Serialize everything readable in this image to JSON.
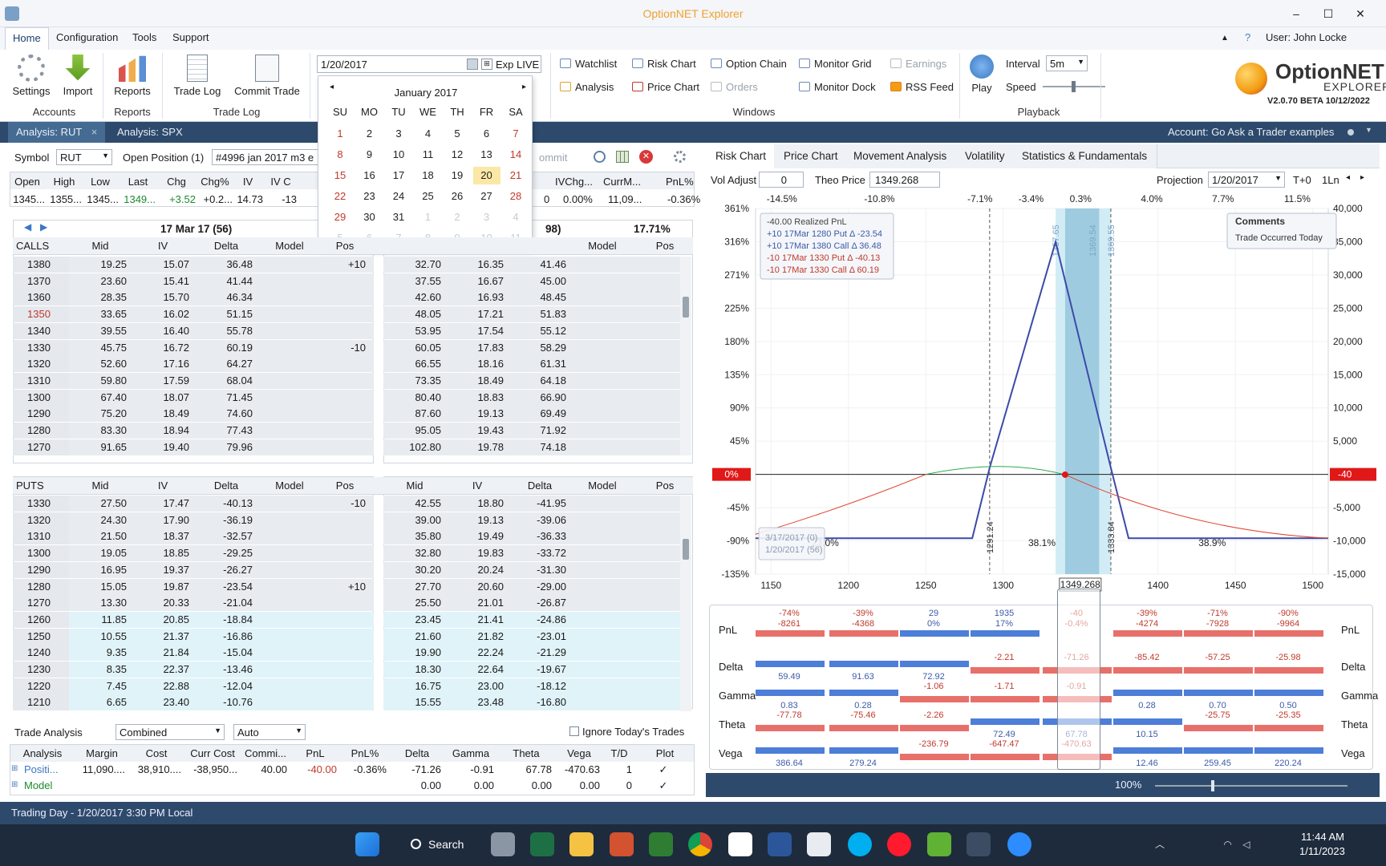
{
  "window": {
    "title": "OptionNET Explorer",
    "user": "User: John Locke"
  },
  "menu": [
    "Home",
    "Configuration",
    "Tools",
    "Support"
  ],
  "ribbon": {
    "settings": "Settings",
    "import": "Import",
    "reports": "Reports",
    "trade_log": "Trade Log",
    "commit_trade": "Commit Trade",
    "groups": {
      "accounts": "Accounts",
      "reports": "Reports",
      "trade_log": "Trade Log",
      "windows": "Windows",
      "playback": "Playback"
    },
    "date_value": "1/20/2017",
    "exp_label": "Exp LIVE",
    "windows": {
      "watchlist": "Watchlist",
      "risk_chart": "Risk Chart",
      "option_chain": "Option Chain",
      "monitor_grid": "Monitor Grid",
      "earnings": "Earnings",
      "analysis": "Analysis",
      "price_chart": "Price Chart",
      "orders": "Orders",
      "monitor_dock": "Monitor Dock",
      "rss_feed": "RSS Feed"
    },
    "play": "Play",
    "interval_label": "Interval",
    "interval_value": "5m",
    "speed_label": "Speed",
    "logo": "OptionNET",
    "logo_sub": "EXPLORER",
    "version": "V2.0.70 BETA 10/12/2022"
  },
  "analysis_tabs": [
    "Analysis: RUT",
    "Analysis: SPX"
  ],
  "account": "Account: Go Ask a Trader examples",
  "symbol": {
    "label": "Symbol",
    "value": "RUT",
    "open_pos_label": "Open Position (1)",
    "open_pos_value": "#4996 jan 2017 m3 e",
    "commit": "ommit"
  },
  "quote": {
    "headers": [
      "Open",
      "High",
      "Low",
      "Last",
      "Chg",
      "Chg%",
      "IV",
      "IV C"
    ],
    "values": [
      "1345...",
      "1355...",
      "1345...",
      "1349...",
      "+3.52",
      "+0.2...",
      "14.73",
      "-13"
    ],
    "headers2": [
      "IVChg...",
      "CurrM...",
      "PnL%"
    ],
    "values2": [
      "0",
      "0.00%",
      "11,09...",
      "-0.36%"
    ]
  },
  "calendar": {
    "month": "January 2017",
    "dow": [
      "SU",
      "MO",
      "TU",
      "WE",
      "TH",
      "FR",
      "SA"
    ],
    "weeks": [
      [
        "1",
        "2",
        "3",
        "4",
        "5",
        "6",
        "7"
      ],
      [
        "8",
        "9",
        "10",
        "11",
        "12",
        "13",
        "14"
      ],
      [
        "15",
        "16",
        "17",
        "18",
        "19",
        "20",
        "21"
      ],
      [
        "22",
        "23",
        "24",
        "25",
        "26",
        "27",
        "28"
      ],
      [
        "29",
        "30",
        "31",
        "1",
        "2",
        "3",
        "4"
      ],
      [
        "5",
        "6",
        "7",
        "8",
        "9",
        "10",
        "11"
      ]
    ],
    "selected": "20"
  },
  "calls": {
    "label": "CALLS",
    "exp_left": "17 Mar 17 (56)",
    "exp_right": "98)",
    "exp_right_iv": "17.71%",
    "cols": [
      "Mid",
      "IV",
      "Delta",
      "Model",
      "Pos"
    ],
    "rows": [
      [
        "1380",
        "19.25",
        "15.07",
        "36.48",
        "+10",
        "32.70",
        "16.35",
        "41.46"
      ],
      [
        "1370",
        "23.60",
        "15.41",
        "41.44",
        "",
        "37.55",
        "16.67",
        "45.00"
      ],
      [
        "1360",
        "28.35",
        "15.70",
        "46.34",
        "",
        "42.60",
        "16.93",
        "48.45"
      ],
      [
        "1350",
        "33.65",
        "16.02",
        "51.15",
        "",
        "48.05",
        "17.21",
        "51.83"
      ],
      [
        "1340",
        "39.55",
        "16.40",
        "55.78",
        "",
        "53.95",
        "17.54",
        "55.12"
      ],
      [
        "1330",
        "45.75",
        "16.72",
        "60.19",
        "-10",
        "60.05",
        "17.83",
        "58.29"
      ],
      [
        "1320",
        "52.60",
        "17.16",
        "64.27",
        "",
        "66.55",
        "18.16",
        "61.31"
      ],
      [
        "1310",
        "59.80",
        "17.59",
        "68.04",
        "",
        "73.35",
        "18.49",
        "64.18"
      ],
      [
        "1300",
        "67.40",
        "18.07",
        "71.45",
        "",
        "80.40",
        "18.83",
        "66.90"
      ],
      [
        "1290",
        "75.20",
        "18.49",
        "74.60",
        "",
        "87.60",
        "19.13",
        "69.49"
      ],
      [
        "1280",
        "83.30",
        "18.94",
        "77.43",
        "",
        "95.05",
        "19.43",
        "71.92"
      ],
      [
        "1270",
        "91.65",
        "19.40",
        "79.96",
        "",
        "102.80",
        "19.78",
        "74.18"
      ]
    ]
  },
  "puts": {
    "label": "PUTS",
    "cols": [
      "Mid",
      "IV",
      "Delta",
      "Model",
      "Pos"
    ],
    "rows": [
      [
        "1330",
        "27.50",
        "17.47",
        "-40.13",
        "-10",
        "42.55",
        "18.80",
        "-41.95"
      ],
      [
        "1320",
        "24.30",
        "17.90",
        "-36.19",
        "",
        "39.00",
        "19.13",
        "-39.06"
      ],
      [
        "1310",
        "21.50",
        "18.37",
        "-32.57",
        "",
        "35.80",
        "19.49",
        "-36.33"
      ],
      [
        "1300",
        "19.05",
        "18.85",
        "-29.25",
        "",
        "32.80",
        "19.83",
        "-33.72"
      ],
      [
        "1290",
        "16.95",
        "19.37",
        "-26.27",
        "",
        "30.20",
        "20.24",
        "-31.30"
      ],
      [
        "1280",
        "15.05",
        "19.87",
        "-23.54",
        "+10",
        "27.70",
        "20.60",
        "-29.00"
      ],
      [
        "1270",
        "13.30",
        "20.33",
        "-21.04",
        "",
        "25.50",
        "21.01",
        "-26.87"
      ],
      [
        "1260",
        "11.85",
        "20.85",
        "-18.84",
        "",
        "23.45",
        "21.41",
        "-24.86"
      ],
      [
        "1250",
        "10.55",
        "21.37",
        "-16.86",
        "",
        "21.60",
        "21.82",
        "-23.01"
      ],
      [
        "1240",
        "9.35",
        "21.84",
        "-15.04",
        "",
        "19.90",
        "22.24",
        "-21.29"
      ],
      [
        "1230",
        "8.35",
        "22.37",
        "-13.46",
        "",
        "18.30",
        "22.64",
        "-19.67"
      ],
      [
        "1220",
        "7.45",
        "22.88",
        "-12.04",
        "",
        "16.75",
        "23.00",
        "-18.12"
      ],
      [
        "1210",
        "6.65",
        "23.40",
        "-10.76",
        "",
        "15.55",
        "23.48",
        "-16.80"
      ]
    ]
  },
  "trade_analysis": {
    "label": "Trade Analysis",
    "mode": "Combined",
    "auto": "Auto",
    "ignore": "Ignore Today's Trades",
    "cols": [
      "Analysis",
      "Margin",
      "Cost",
      "Curr Cost",
      "Commi...",
      "PnL",
      "PnL%",
      "Delta",
      "Gamma",
      "Theta",
      "Vega",
      "T/D",
      "Plot"
    ],
    "rows": [
      [
        "Positi...",
        "11,090....",
        "38,910....",
        "-38,950...",
        "40.00",
        "-40.00",
        "-0.36%",
        "-71.26",
        "-0.91",
        "67.78",
        "-470.63",
        "1",
        "✓"
      ],
      [
        "Model",
        "",
        "",
        "",
        "",
        "",
        "",
        "0.00",
        "0.00",
        "0.00",
        "0.00",
        "0",
        "✓"
      ]
    ]
  },
  "chart_tabs": [
    "Risk Chart",
    "Price Chart",
    "Movement Analysis",
    "Volatility",
    "Statistics & Fundamentals"
  ],
  "chart_ctrl": {
    "vol_label": "Vol Adjust",
    "vol_value": "0",
    "theo_label": "Theo Price",
    "theo_value": "1349.268",
    "proj_label": "Projection",
    "proj_value": "1/20/2017",
    "tplus": "T+0",
    "ln": "1Ln"
  },
  "chart_data": {
    "type": "line",
    "top_pct_labels": [
      "-14.5%",
      "-10.8%",
      "-7.1%",
      "-3.4%",
      "0.3%",
      "4.0%",
      "7.7%",
      "11.5%"
    ],
    "x_ticks": [
      1150,
      1200,
      1250,
      1300,
      1400,
      1450,
      1500
    ],
    "xlim": [
      1140,
      1510
    ],
    "current_price": "1349.268",
    "y_left": [
      "361%",
      "316%",
      "271%",
      "225%",
      "180%",
      "135%",
      "90%",
      "45%",
      "0%",
      "-45%",
      "-90%",
      "-135%"
    ],
    "y_right": [
      "40,000",
      "35,000",
      "30,000",
      "25,000",
      "20,000",
      "15,000",
      "10,000",
      "5,000",
      "-40",
      "-5,000",
      "-10,000",
      "-15,000"
    ],
    "ylim": [
      -15000,
      40000
    ],
    "expiry_series": {
      "x": [
        1140,
        1280,
        1291.24,
        1333.84,
        1369.54,
        1381,
        1510
      ],
      "y": [
        -9600,
        -9600,
        1000,
        35000,
        1000,
        -9600,
        -9600
      ]
    },
    "t0_series_green": {
      "x": [
        1250,
        1291,
        1315,
        1340
      ],
      "y": [
        0,
        1900,
        1800,
        -40
      ]
    },
    "t0_series_red": {
      "x": [
        1140,
        1200,
        1250
      ],
      "y": [
        -9000,
        -4500,
        0
      ]
    },
    "t0_series_red2": {
      "x": [
        1340,
        1400,
        1450,
        1510
      ],
      "y": [
        -40,
        -4200,
        -8000,
        -9600
      ]
    },
    "vlines": [
      "1291.24",
      "1333.84",
      "1357.65",
      "1369.54",
      "1369.55"
    ],
    "zone_pcts": [
      "23.0%",
      "38.1%",
      "38.9%"
    ],
    "legend": [
      "-40.00 Realized PnL",
      "+10 17Mar 1280 Put Δ  -23.54",
      "+10 17Mar 1380 Call Δ  36.48",
      "-10 17Mar 1330 Put Δ  -40.13",
      "-10 17Mar 1330 Call Δ  60.19"
    ],
    "comments_title": "Comments",
    "comments_text": "Trade Occurred Today",
    "date_box": [
      "3/17/2017 (0)",
      "1/20/2017 (56)"
    ]
  },
  "greeks": {
    "labels": [
      "PnL",
      "Delta",
      "Gamma",
      "Theta",
      "Vega"
    ],
    "pnl": [
      [
        "-74%",
        "-8261"
      ],
      [
        "-39%",
        "-4368"
      ],
      [
        "29",
        "0%"
      ],
      [
        "1935",
        "17%"
      ],
      [
        "-40",
        "-0.4%"
      ],
      [
        "-39%",
        "-4274"
      ],
      [
        "-71%",
        "-7928"
      ],
      [
        "-90%",
        "-9964"
      ]
    ],
    "delta": [
      "59.49",
      "91.63",
      "72.92",
      "-2.21",
      "-71.26",
      "-85.42",
      "-57.25",
      "-25.98"
    ],
    "gamma": [
      "0.83",
      "0.28",
      "-1.06",
      "-1.71",
      "-0.91",
      "0.28",
      "0.70",
      "0.50"
    ],
    "theta": [
      "-77.78",
      "-75.46",
      "-2.26",
      "72.49",
      "67.78",
      "10.15",
      "-25.75",
      "-25.35"
    ],
    "vega": [
      "386.64",
      "279.24",
      "-236.79",
      "-647.47",
      "-470.63",
      "12.46",
      "259.45",
      "220.24"
    ]
  },
  "zoom": "100%",
  "status": "Trading Day - 1/20/2017 3:30 PM Local",
  "taskbar": {
    "search": "Search",
    "time": "11:44 AM",
    "date": "1/11/2023"
  }
}
